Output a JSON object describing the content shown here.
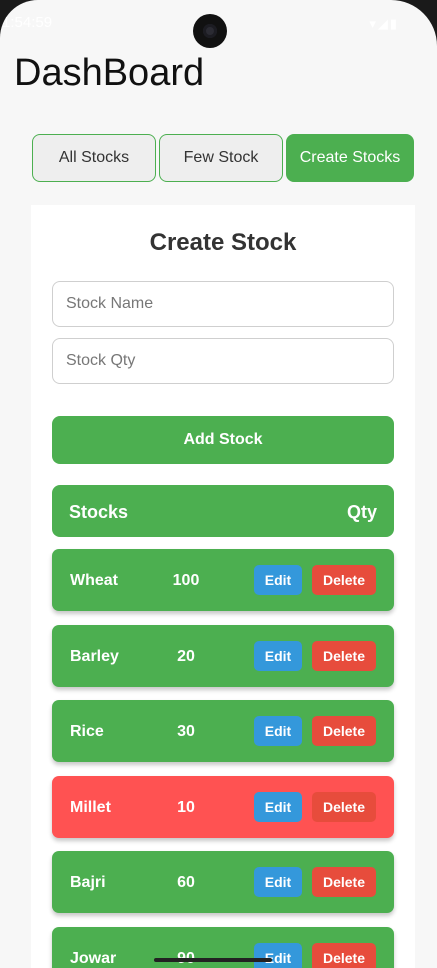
{
  "status_bar": {
    "time": "1:54:59",
    "icons": "signal-wifi-battery"
  },
  "app": {
    "title": "DashBoard"
  },
  "tabs": [
    {
      "label": "All Stocks",
      "active": false
    },
    {
      "label": "Few Stock",
      "active": false
    },
    {
      "label": "Create Stocks",
      "active": true
    }
  ],
  "form": {
    "title": "Create Stock",
    "name_placeholder": "Stock Name",
    "qty_placeholder": "Stock Qty",
    "add_label": "Add Stock"
  },
  "table": {
    "headers": {
      "name": "Stocks",
      "qty": "Qty"
    },
    "edit_label": "Edit",
    "delete_label": "Delete",
    "rows": [
      {
        "name": "Wheat",
        "qty": "100",
        "low": false
      },
      {
        "name": "Barley",
        "qty": "20",
        "low": false
      },
      {
        "name": "Rice",
        "qty": "30",
        "low": false
      },
      {
        "name": "Millet",
        "qty": "10",
        "low": true
      },
      {
        "name": "Bajri",
        "qty": "60",
        "low": false
      },
      {
        "name": "Jowar",
        "qty": "90",
        "low": false
      }
    ]
  },
  "colors": {
    "primary_green": "#4caf50",
    "low_stock_red": "#ff5252",
    "edit_blue": "#3498db",
    "delete_red": "#e74c3c"
  }
}
